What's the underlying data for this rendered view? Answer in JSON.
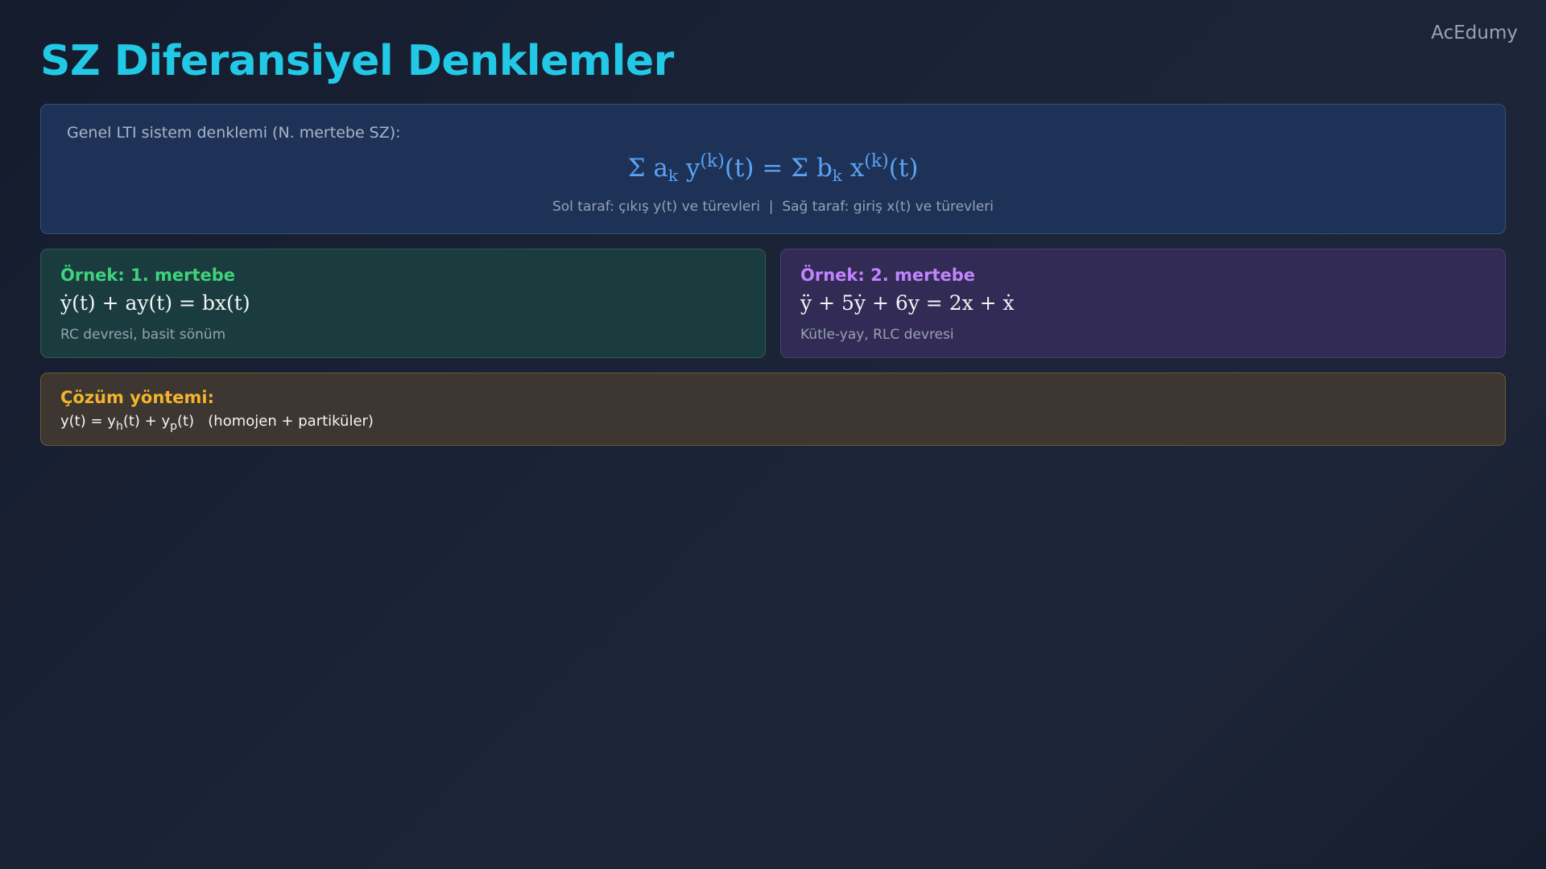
{
  "brand": "AcEdumy",
  "title": "SZ Diferansiyel Denklemler",
  "general": {
    "lead": "Genel LTI sistem denklemi (N. mertebe SZ):",
    "formula": {
      "sigma_left": "Σ a",
      "sub_left": "k",
      "y_var": " y",
      "sup_left": "(k)",
      "mid": "(t) = Σ b",
      "sub_right": "k",
      "x_var": " x",
      "sup_right": "(k)",
      "end": "(t)"
    },
    "note": "Sol taraf: çıkış y(t) ve türevleri  |  Sağ taraf: giriş x(t) ve türevleri"
  },
  "examples": [
    {
      "title": "Örnek: 1. mertebe",
      "equation": "ẏ(t) + ay(t) = bx(t)",
      "description": "RC devresi, basit sönüm",
      "accent": "#3fd27b"
    },
    {
      "title": "Örnek: 2. mertebe",
      "equation": "ÿ + 5ẏ + 6y = 2x + ẋ",
      "description": "Kütle-yay, RLC devresi",
      "accent": "#c084fc"
    }
  ],
  "method": {
    "title": "Çözüm yöntemi:",
    "expr": {
      "p1": "y(t) = y",
      "s1": "h",
      "p2": "(t) + y",
      "s2": "p",
      "p3": "(t)",
      "tail": "   (homojen + partiküler)"
    },
    "accent": "#f2b42c"
  }
}
